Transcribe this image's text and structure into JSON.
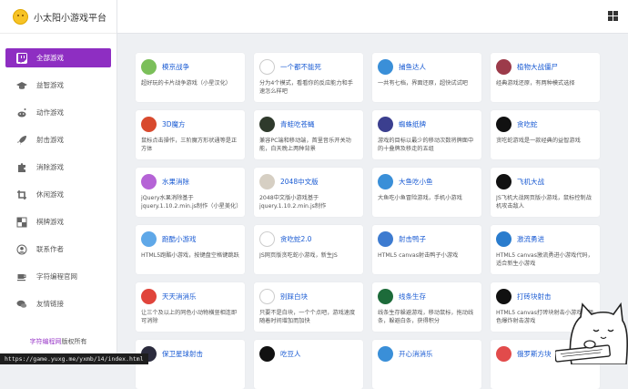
{
  "app": {
    "title": "小太阳小游戏平台"
  },
  "sidebar": {
    "items": [
      {
        "label": "全部游戏",
        "icon": "twitch-icon",
        "active": true
      },
      {
        "label": "益智游戏",
        "icon": "graduation-cap-icon"
      },
      {
        "label": "动作游戏",
        "icon": "reddit-icon"
      },
      {
        "label": "射击游戏",
        "icon": "rocket-icon"
      },
      {
        "label": "消除游戏",
        "icon": "puzzle-piece-icon"
      },
      {
        "label": "休闲游戏",
        "icon": "crop-icon"
      },
      {
        "label": "棋牌游戏",
        "icon": "checkerboard-icon"
      },
      {
        "label": "联系作者",
        "icon": "user-circle-icon"
      },
      {
        "label": "字符编程官网",
        "icon": "coffee-icon"
      },
      {
        "label": "友情链接",
        "icon": "chat-bubbles-icon"
      }
    ],
    "copyright_link": "字符编程网",
    "copyright_suffix": "版权所有"
  },
  "status_url": "https://game.yuxg.me/yxmb/14/index.html",
  "games": [
    {
      "title": "模京战争",
      "desc": "超好玩的卡片战争游戏（小星汉化）",
      "icon": "soldier-icon",
      "color": "#7bbf5a"
    },
    {
      "title": "一个都不能死",
      "desc": "分为4个模式，看看你的反应能力和手速怎么样吧",
      "icon": "stickman-icon",
      "color": "#ffffff"
    },
    {
      "title": "捕鱼达人",
      "desc": "一共有七档，界面还原，超快试试吧",
      "icon": "fish-icon",
      "color": "#3a8fd8"
    },
    {
      "title": "植物大战僵尸",
      "desc": "经典游戏还原，有两种模式选择",
      "icon": "zombie-icon",
      "color": "#9c3b4a"
    },
    {
      "title": "3D魔方",
      "desc": "鼠标点击操作，三阶魔方形状通等是正方体",
      "icon": "rubik-cube-icon",
      "color": "#d84a2e"
    },
    {
      "title": "青蛙吃苍蝇",
      "desc": "兼容PC端和移动端，首里音乐开关功能，白天晚上两种背景",
      "icon": "frog-icon",
      "color": "#2f3a2c"
    },
    {
      "title": "蜘蛛纸牌",
      "desc": "游戏的目标以最少的移动次数将牌面中的十叠牌及移走的五组",
      "icon": "spider-cards-icon",
      "color": "#3b3f8f"
    },
    {
      "title": "贪吃蛇",
      "desc": "贪吃蛇游戏是一款经典的益智游戏",
      "icon": "snake-icon",
      "color": "#111111"
    },
    {
      "title": "水果消除",
      "desc": "jQuery水果消除基于jquery.1.10.2.min.js制作（小星美化）",
      "icon": "fruit-icon",
      "color": "#b563d6"
    },
    {
      "title": "2048中文版",
      "desc": "2048中文版小游戏基于jquery.1.10.2.min.js制作",
      "icon": "tile-2048-icon",
      "color": "#d6cfc3"
    },
    {
      "title": "大鱼吃小鱼",
      "desc": "大鱼吃小鱼冒险游戏，手机小游戏",
      "icon": "big-fish-icon",
      "color": "#3a8fd8"
    },
    {
      "title": "飞机大战",
      "desc": "JS飞机大战网页版小游戏，鼠标控制战机攻击敌人",
      "icon": "airplane-icon",
      "color": "#111111"
    },
    {
      "title": "跑酷小游戏",
      "desc": "HTML5跑酷小游戏，按键盘空格键跳跃",
      "icon": "runner-icon",
      "color": "#5fa8e8"
    },
    {
      "title": "贪吃蛇2.0",
      "desc": "JS网页版贪吃蛇小游戏，新生JS",
      "icon": "dots-icon",
      "color": "#ffffff"
    },
    {
      "title": "射击鸭子",
      "desc": "HTML5 canvas射击鸭子小游戏",
      "icon": "duck-icon",
      "color": "#3d7bd0"
    },
    {
      "title": "激流勇进",
      "desc": "HTML5 canvas激流勇进小游戏代码，适合新生小游戏",
      "icon": "rapids-icon",
      "color": "#2a7ccd"
    },
    {
      "title": "天天消消乐",
      "desc": "让三个及以上的同色小动物横竖相连即可消除",
      "icon": "match-three-icon",
      "color": "#e0443b"
    },
    {
      "title": "别踩白块",
      "desc": "只要不是白块，一个个点吧，游戏速度随着时间增加而加快",
      "icon": "piano-tiles-icon",
      "color": "#ffffff"
    },
    {
      "title": "线条生存",
      "desc": "线条生存躲避游戏，移动鼠标，拖动线条，躲避白条，获得积分",
      "icon": "line-survive-icon",
      "color": "#1d6b3a"
    },
    {
      "title": "打砖块射击",
      "desc": "HTML5 canvas打砖块射击小游戏，颜色爆炸射击游戏",
      "icon": "brick-shooter-icon",
      "color": "#111111"
    },
    {
      "title": "保卫星球射击",
      "desc": "",
      "icon": "planet-icon",
      "color": "#2b2b3d"
    },
    {
      "title": "吃豆人",
      "desc": "",
      "icon": "pacman-icon",
      "color": "#111111"
    },
    {
      "title": "开心消消乐",
      "desc": "",
      "icon": "happy-match-icon",
      "color": "#3a8fd8"
    },
    {
      "title": "俄罗斯方块",
      "desc": "",
      "icon": "tetris-icon",
      "color": "#e24b4b"
    }
  ]
}
